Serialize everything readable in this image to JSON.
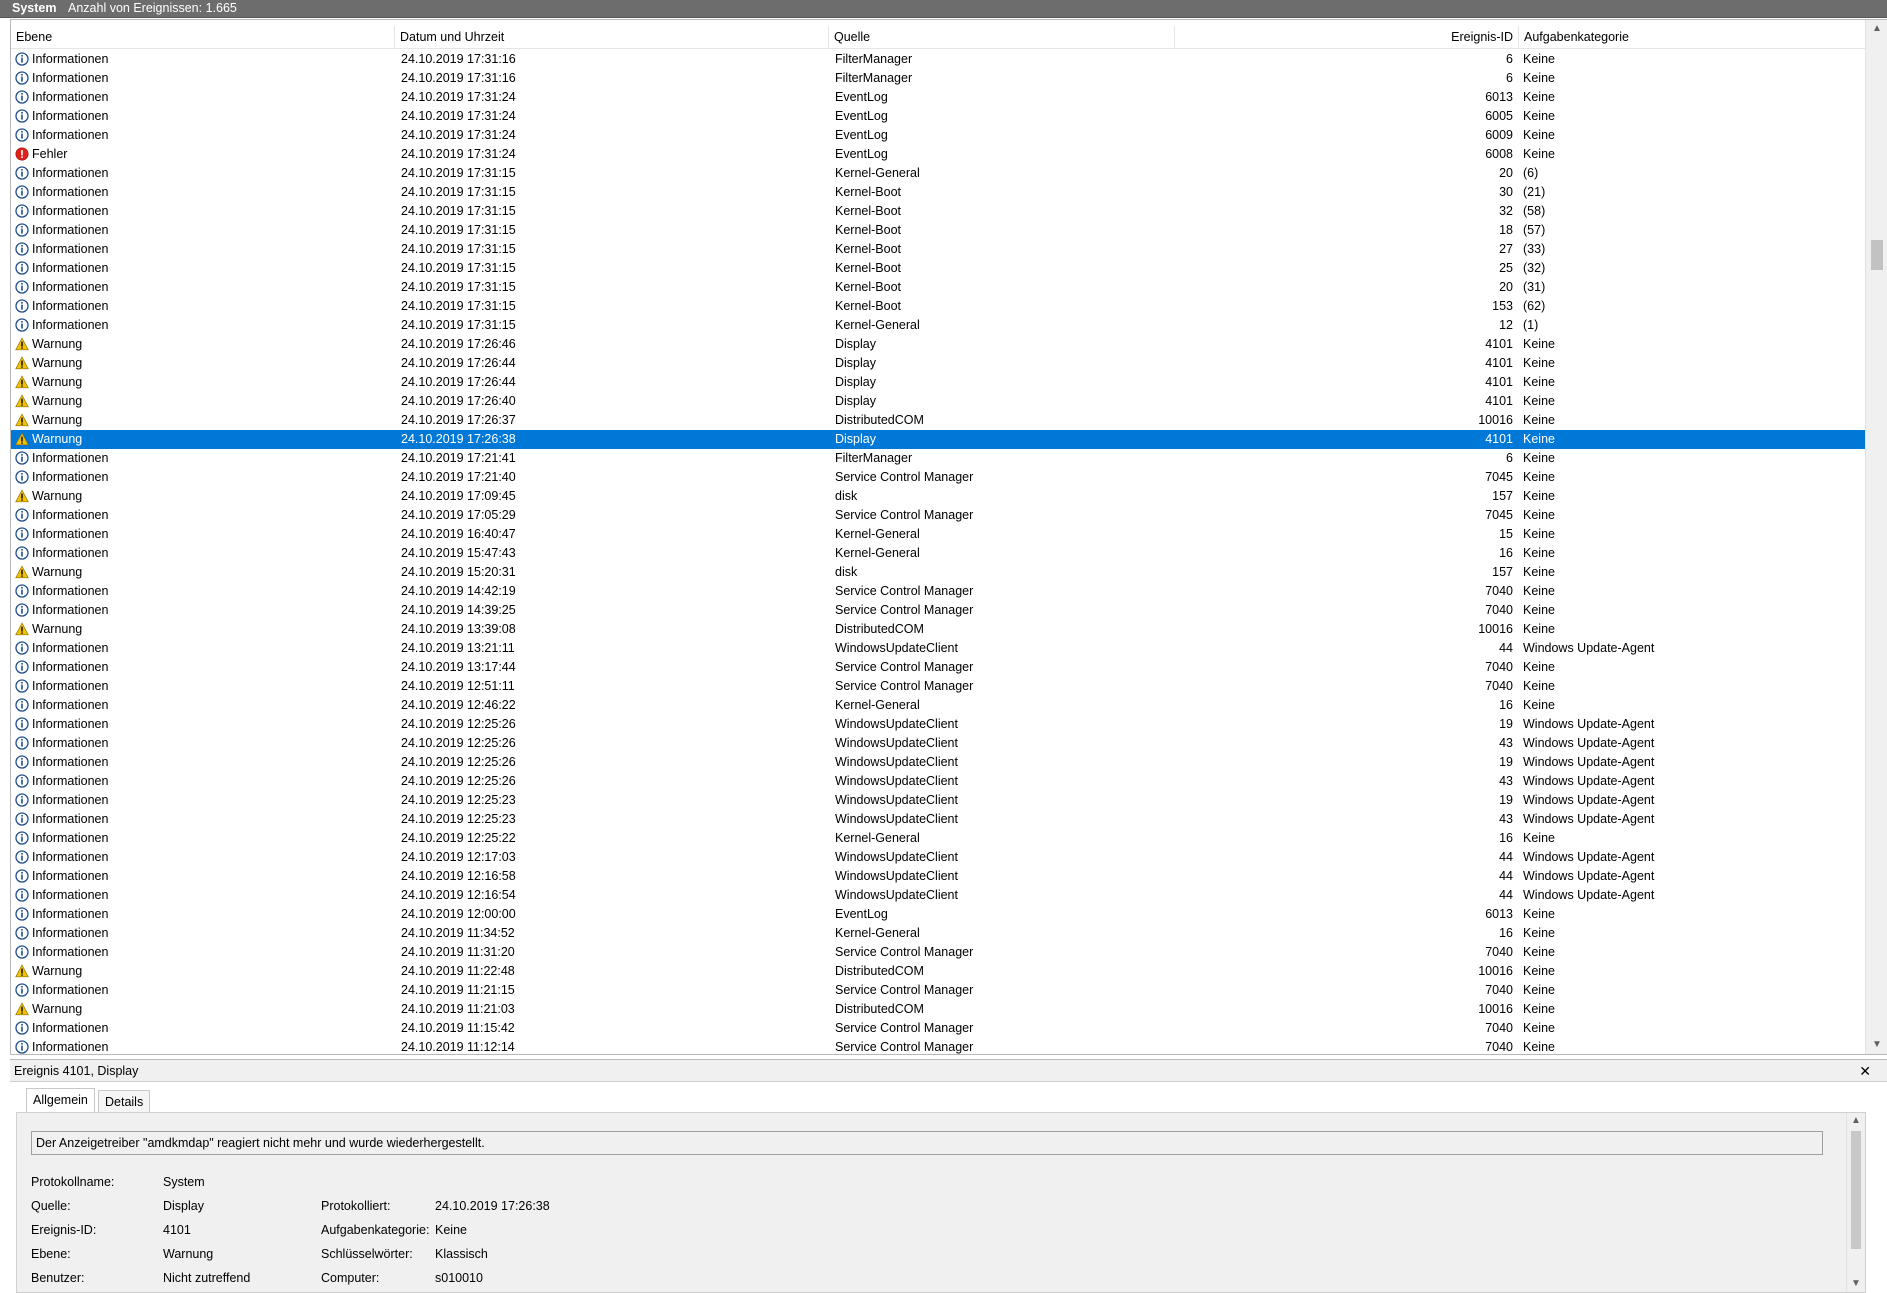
{
  "titlebar": {
    "log_name": "System",
    "event_count": "Anzahl von Ereignissen: 1.665"
  },
  "columns": {
    "level": "Ebene",
    "date": "Datum und Uhrzeit",
    "source": "Quelle",
    "event_id": "Ereignis-ID",
    "category": "Aufgabenkategorie"
  },
  "icons": {
    "info": "info-icon",
    "warning": "warning-icon",
    "error": "error-icon"
  },
  "colors": {
    "selection": "#0078d7",
    "info": "#1f4e8c",
    "warning": "#f2c200",
    "error": "#e0201b"
  },
  "events": [
    {
      "level": "Informationen",
      "type": "info",
      "date": "24.10.2019 17:31:16",
      "source": "FilterManager",
      "id": "6",
      "category": "Keine"
    },
    {
      "level": "Informationen",
      "type": "info",
      "date": "24.10.2019 17:31:16",
      "source": "FilterManager",
      "id": "6",
      "category": "Keine"
    },
    {
      "level": "Informationen",
      "type": "info",
      "date": "24.10.2019 17:31:24",
      "source": "EventLog",
      "id": "6013",
      "category": "Keine"
    },
    {
      "level": "Informationen",
      "type": "info",
      "date": "24.10.2019 17:31:24",
      "source": "EventLog",
      "id": "6005",
      "category": "Keine"
    },
    {
      "level": "Informationen",
      "type": "info",
      "date": "24.10.2019 17:31:24",
      "source": "EventLog",
      "id": "6009",
      "category": "Keine"
    },
    {
      "level": "Fehler",
      "type": "error",
      "date": "24.10.2019 17:31:24",
      "source": "EventLog",
      "id": "6008",
      "category": "Keine"
    },
    {
      "level": "Informationen",
      "type": "info",
      "date": "24.10.2019 17:31:15",
      "source": "Kernel-General",
      "id": "20",
      "category": "(6)"
    },
    {
      "level": "Informationen",
      "type": "info",
      "date": "24.10.2019 17:31:15",
      "source": "Kernel-Boot",
      "id": "30",
      "category": "(21)"
    },
    {
      "level": "Informationen",
      "type": "info",
      "date": "24.10.2019 17:31:15",
      "source": "Kernel-Boot",
      "id": "32",
      "category": "(58)"
    },
    {
      "level": "Informationen",
      "type": "info",
      "date": "24.10.2019 17:31:15",
      "source": "Kernel-Boot",
      "id": "18",
      "category": "(57)"
    },
    {
      "level": "Informationen",
      "type": "info",
      "date": "24.10.2019 17:31:15",
      "source": "Kernel-Boot",
      "id": "27",
      "category": "(33)"
    },
    {
      "level": "Informationen",
      "type": "info",
      "date": "24.10.2019 17:31:15",
      "source": "Kernel-Boot",
      "id": "25",
      "category": "(32)"
    },
    {
      "level": "Informationen",
      "type": "info",
      "date": "24.10.2019 17:31:15",
      "source": "Kernel-Boot",
      "id": "20",
      "category": "(31)"
    },
    {
      "level": "Informationen",
      "type": "info",
      "date": "24.10.2019 17:31:15",
      "source": "Kernel-Boot",
      "id": "153",
      "category": "(62)"
    },
    {
      "level": "Informationen",
      "type": "info",
      "date": "24.10.2019 17:31:15",
      "source": "Kernel-General",
      "id": "12",
      "category": "(1)"
    },
    {
      "level": "Warnung",
      "type": "warning",
      "date": "24.10.2019 17:26:46",
      "source": "Display",
      "id": "4101",
      "category": "Keine"
    },
    {
      "level": "Warnung",
      "type": "warning",
      "date": "24.10.2019 17:26:44",
      "source": "Display",
      "id": "4101",
      "category": "Keine"
    },
    {
      "level": "Warnung",
      "type": "warning",
      "date": "24.10.2019 17:26:44",
      "source": "Display",
      "id": "4101",
      "category": "Keine"
    },
    {
      "level": "Warnung",
      "type": "warning",
      "date": "24.10.2019 17:26:40",
      "source": "Display",
      "id": "4101",
      "category": "Keine"
    },
    {
      "level": "Warnung",
      "type": "warning",
      "date": "24.10.2019 17:26:37",
      "source": "DistributedCOM",
      "id": "10016",
      "category": "Keine"
    },
    {
      "level": "Warnung",
      "type": "warning",
      "date": "24.10.2019 17:26:38",
      "source": "Display",
      "id": "4101",
      "category": "Keine",
      "selected": true
    },
    {
      "level": "Informationen",
      "type": "info",
      "date": "24.10.2019 17:21:41",
      "source": "FilterManager",
      "id": "6",
      "category": "Keine"
    },
    {
      "level": "Informationen",
      "type": "info",
      "date": "24.10.2019 17:21:40",
      "source": "Service Control Manager",
      "id": "7045",
      "category": "Keine"
    },
    {
      "level": "Warnung",
      "type": "warning",
      "date": "24.10.2019 17:09:45",
      "source": "disk",
      "id": "157",
      "category": "Keine"
    },
    {
      "level": "Informationen",
      "type": "info",
      "date": "24.10.2019 17:05:29",
      "source": "Service Control Manager",
      "id": "7045",
      "category": "Keine"
    },
    {
      "level": "Informationen",
      "type": "info",
      "date": "24.10.2019 16:40:47",
      "source": "Kernel-General",
      "id": "15",
      "category": "Keine"
    },
    {
      "level": "Informationen",
      "type": "info",
      "date": "24.10.2019 15:47:43",
      "source": "Kernel-General",
      "id": "16",
      "category": "Keine"
    },
    {
      "level": "Warnung",
      "type": "warning",
      "date": "24.10.2019 15:20:31",
      "source": "disk",
      "id": "157",
      "category": "Keine"
    },
    {
      "level": "Informationen",
      "type": "info",
      "date": "24.10.2019 14:42:19",
      "source": "Service Control Manager",
      "id": "7040",
      "category": "Keine"
    },
    {
      "level": "Informationen",
      "type": "info",
      "date": "24.10.2019 14:39:25",
      "source": "Service Control Manager",
      "id": "7040",
      "category": "Keine"
    },
    {
      "level": "Warnung",
      "type": "warning",
      "date": "24.10.2019 13:39:08",
      "source": "DistributedCOM",
      "id": "10016",
      "category": "Keine"
    },
    {
      "level": "Informationen",
      "type": "info",
      "date": "24.10.2019 13:21:11",
      "source": "WindowsUpdateClient",
      "id": "44",
      "category": "Windows Update-Agent"
    },
    {
      "level": "Informationen",
      "type": "info",
      "date": "24.10.2019 13:17:44",
      "source": "Service Control Manager",
      "id": "7040",
      "category": "Keine"
    },
    {
      "level": "Informationen",
      "type": "info",
      "date": "24.10.2019 12:51:11",
      "source": "Service Control Manager",
      "id": "7040",
      "category": "Keine"
    },
    {
      "level": "Informationen",
      "type": "info",
      "date": "24.10.2019 12:46:22",
      "source": "Kernel-General",
      "id": "16",
      "category": "Keine"
    },
    {
      "level": "Informationen",
      "type": "info",
      "date": "24.10.2019 12:25:26",
      "source": "WindowsUpdateClient",
      "id": "19",
      "category": "Windows Update-Agent"
    },
    {
      "level": "Informationen",
      "type": "info",
      "date": "24.10.2019 12:25:26",
      "source": "WindowsUpdateClient",
      "id": "43",
      "category": "Windows Update-Agent"
    },
    {
      "level": "Informationen",
      "type": "info",
      "date": "24.10.2019 12:25:26",
      "source": "WindowsUpdateClient",
      "id": "19",
      "category": "Windows Update-Agent"
    },
    {
      "level": "Informationen",
      "type": "info",
      "date": "24.10.2019 12:25:26",
      "source": "WindowsUpdateClient",
      "id": "43",
      "category": "Windows Update-Agent"
    },
    {
      "level": "Informationen",
      "type": "info",
      "date": "24.10.2019 12:25:23",
      "source": "WindowsUpdateClient",
      "id": "19",
      "category": "Windows Update-Agent"
    },
    {
      "level": "Informationen",
      "type": "info",
      "date": "24.10.2019 12:25:23",
      "source": "WindowsUpdateClient",
      "id": "43",
      "category": "Windows Update-Agent"
    },
    {
      "level": "Informationen",
      "type": "info",
      "date": "24.10.2019 12:25:22",
      "source": "Kernel-General",
      "id": "16",
      "category": "Keine"
    },
    {
      "level": "Informationen",
      "type": "info",
      "date": "24.10.2019 12:17:03",
      "source": "WindowsUpdateClient",
      "id": "44",
      "category": "Windows Update-Agent"
    },
    {
      "level": "Informationen",
      "type": "info",
      "date": "24.10.2019 12:16:58",
      "source": "WindowsUpdateClient",
      "id": "44",
      "category": "Windows Update-Agent"
    },
    {
      "level": "Informationen",
      "type": "info",
      "date": "24.10.2019 12:16:54",
      "source": "WindowsUpdateClient",
      "id": "44",
      "category": "Windows Update-Agent"
    },
    {
      "level": "Informationen",
      "type": "info",
      "date": "24.10.2019 12:00:00",
      "source": "EventLog",
      "id": "6013",
      "category": "Keine"
    },
    {
      "level": "Informationen",
      "type": "info",
      "date": "24.10.2019 11:34:52",
      "source": "Kernel-General",
      "id": "16",
      "category": "Keine"
    },
    {
      "level": "Informationen",
      "type": "info",
      "date": "24.10.2019 11:31:20",
      "source": "Service Control Manager",
      "id": "7040",
      "category": "Keine"
    },
    {
      "level": "Warnung",
      "type": "warning",
      "date": "24.10.2019 11:22:48",
      "source": "DistributedCOM",
      "id": "10016",
      "category": "Keine"
    },
    {
      "level": "Informationen",
      "type": "info",
      "date": "24.10.2019 11:21:15",
      "source": "Service Control Manager",
      "id": "7040",
      "category": "Keine"
    },
    {
      "level": "Warnung",
      "type": "warning",
      "date": "24.10.2019 11:21:03",
      "source": "DistributedCOM",
      "id": "10016",
      "category": "Keine"
    },
    {
      "level": "Informationen",
      "type": "info",
      "date": "24.10.2019 11:15:42",
      "source": "Service Control Manager",
      "id": "7040",
      "category": "Keine"
    },
    {
      "level": "Informationen",
      "type": "info",
      "date": "24.10.2019 11:12:14",
      "source": "Service Control Manager",
      "id": "7040",
      "category": "Keine"
    }
  ],
  "detail": {
    "title": "Ereignis 4101, Display",
    "close_glyph": "✕",
    "tabs": [
      {
        "label": "Allgemein",
        "active": true
      },
      {
        "label": "Details",
        "active": false
      }
    ],
    "message": "Der Anzeigetreiber \"amdkmdap\" reagiert nicht mehr und wurde wiederhergestellt.",
    "fields_left": [
      {
        "label": "Protokollname:",
        "value": "System"
      },
      {
        "label": "Quelle:",
        "value": "Display"
      },
      {
        "label": "Ereignis-ID:",
        "value": "4101"
      },
      {
        "label": "Ebene:",
        "value": "Warnung"
      },
      {
        "label": "Benutzer:",
        "value": "Nicht zutreffend"
      }
    ],
    "fields_right": [
      {
        "label": "Protokolliert:",
        "value": "24.10.2019 17:26:38"
      },
      {
        "label": "Aufgabenkategorie:",
        "value": "Keine"
      },
      {
        "label": "Schlüsselwörter:",
        "value": "Klassisch"
      },
      {
        "label": "Computer:",
        "value": "s010010"
      }
    ]
  }
}
